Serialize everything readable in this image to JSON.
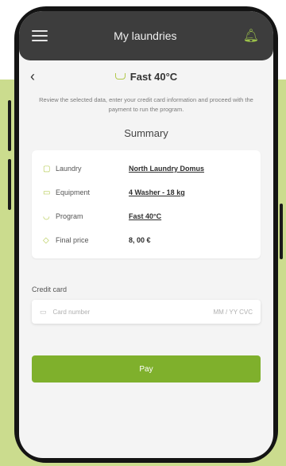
{
  "app": {
    "title": "My laundries"
  },
  "program": {
    "title": "Fast 40°C"
  },
  "intro": "Review the selected data, enter your credit card information and proceed with the payment to run the program.",
  "summary": {
    "heading": "Summary",
    "rows": [
      {
        "icon": "laundry-icon",
        "label": "Laundry",
        "value": "North Laundry Domus"
      },
      {
        "icon": "washer-icon",
        "label": "Equipment",
        "value": "4 Washer - 18 kg"
      },
      {
        "icon": "program-icon",
        "label": "Program",
        "value": "Fast 40°C"
      },
      {
        "icon": "price-tag-icon",
        "label": "Final price",
        "value": "8, 00 €"
      }
    ]
  },
  "credit_card": {
    "label": "Credit card",
    "number_placeholder": "Card number",
    "expiry_cvc_placeholder": "MM / YY  CVC"
  },
  "pay_button": {
    "label": "Pay"
  },
  "colors": {
    "accent": "#7fb02c",
    "background": "#cbdc8e",
    "topbar": "#3d3d3d"
  }
}
